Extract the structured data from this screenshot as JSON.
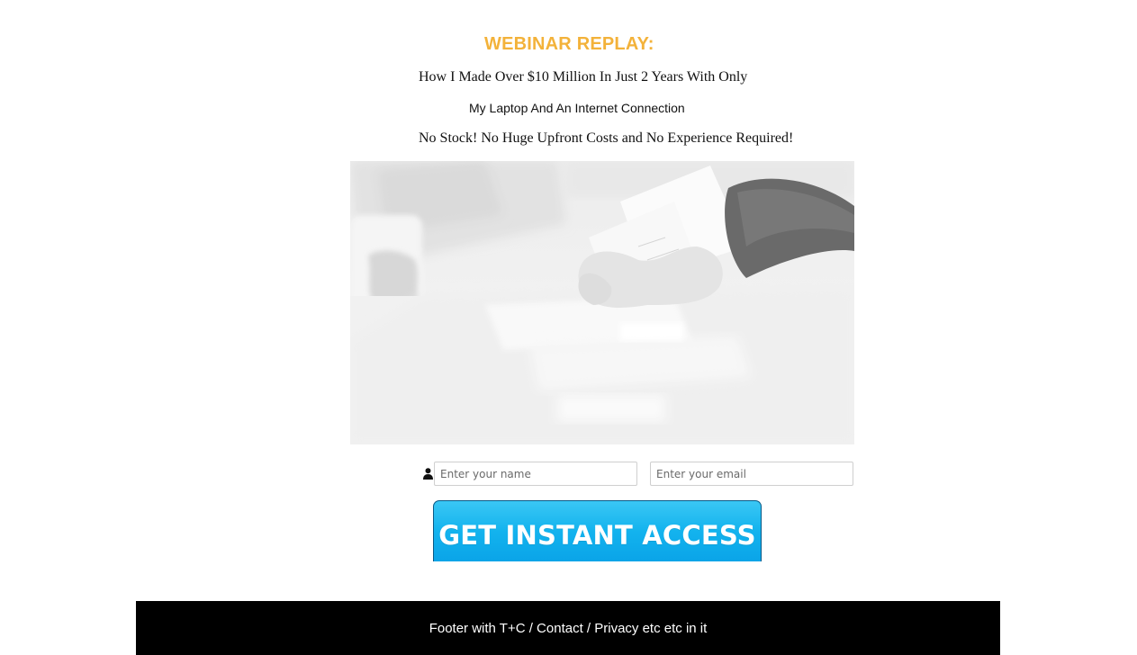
{
  "header": {
    "headline": "WEBINAR REPLAY:",
    "subline_1": "How I Made Over $10 Million In Just 2 Years With Only",
    "subline_2": "My Laptop And An Internet Connection",
    "subline_3": "No Stock! No Huge Upfront Costs and No Experience Required!"
  },
  "form": {
    "name_placeholder": "Enter your name",
    "email_placeholder": "Enter your email",
    "name_icon": "person-icon",
    "submit_label": "GET INSTANT ACCESS"
  },
  "footer": {
    "text": "Footer with T+C / Contact / Privacy etc etc in it"
  },
  "colors": {
    "headline": "#f3b23a",
    "cta_blue": "#13b3ee",
    "footer_bg": "#000000"
  }
}
